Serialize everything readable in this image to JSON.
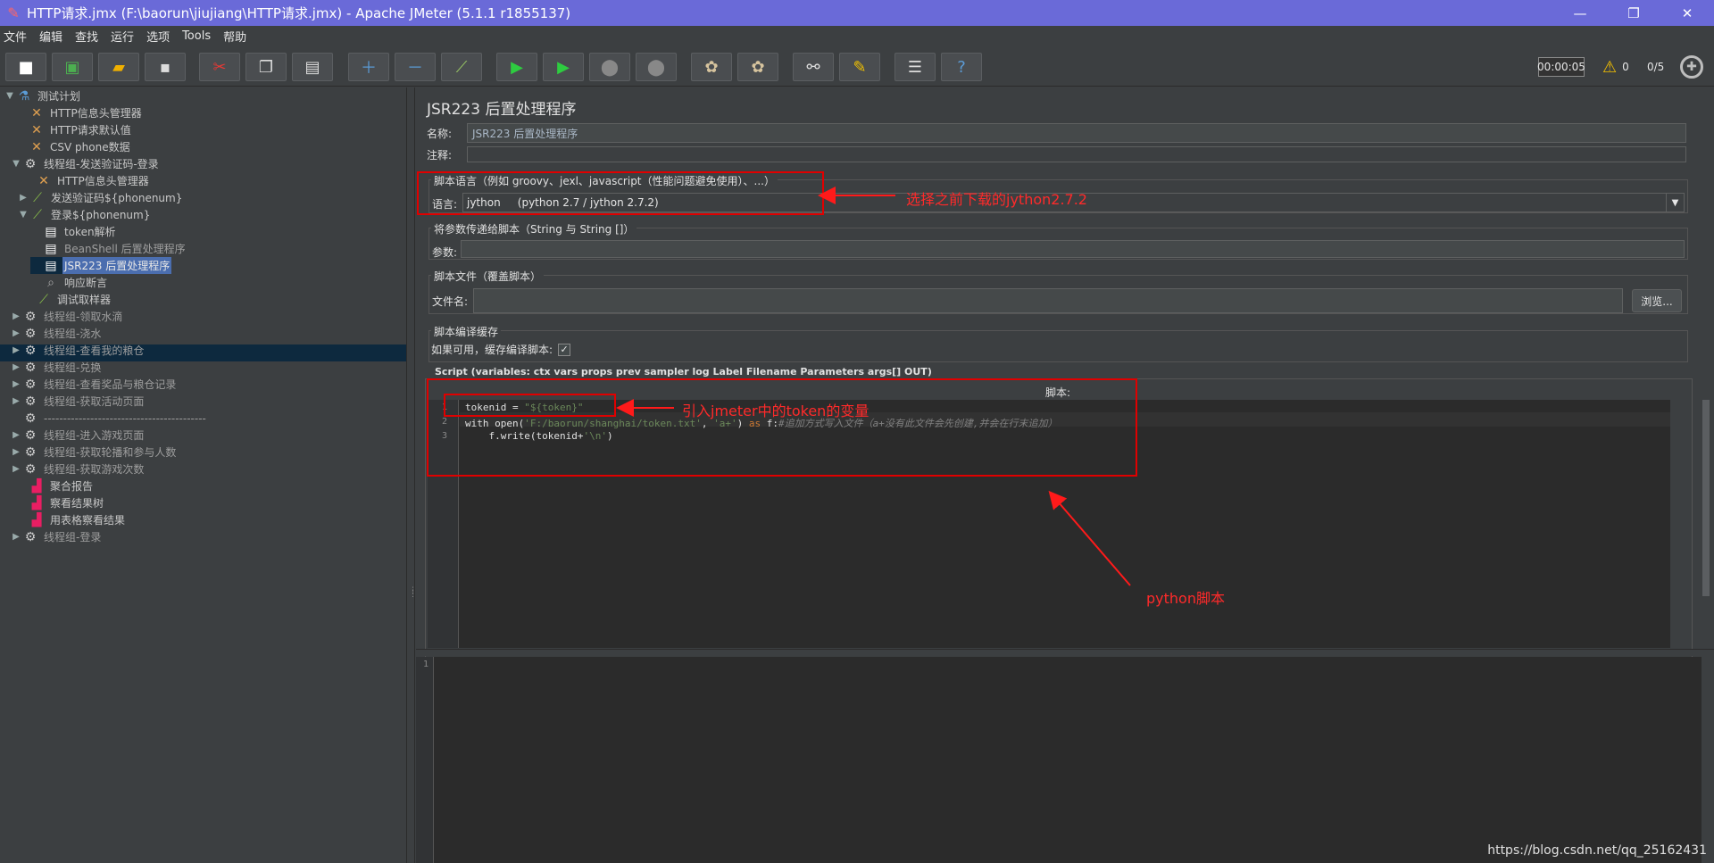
{
  "window": {
    "title": "HTTP请求.jmx (F:\\baorun\\jiujiang\\HTTP请求.jmx) - Apache JMeter (5.1.1 r1855137)",
    "minimize": "—",
    "restore": "❐",
    "close": "✕"
  },
  "menu": [
    "文件",
    "编辑",
    "查找",
    "运行",
    "选项",
    "Tools",
    "帮助"
  ],
  "toolbar": {
    "timer": "00:00:05",
    "warnings": "0",
    "threads": "0/5"
  },
  "tree": [
    {
      "label": "测试计划",
      "icon": "flask-icon"
    },
    {
      "label": "HTTP信息头管理器",
      "icon": "wrench-icon"
    },
    {
      "label": "HTTP请求默认值",
      "icon": "wrench-icon"
    },
    {
      "label": "CSV phone数据",
      "icon": "wrench-icon"
    },
    {
      "label": "线程组-发送验证码-登录",
      "icon": "gear-icon"
    },
    {
      "label": "HTTP信息头管理器",
      "icon": "wrench-icon"
    },
    {
      "label": "发送验证码${phonenum}",
      "icon": "pipette-icon"
    },
    {
      "label": "登录${phonenum}",
      "icon": "pipette-icon"
    },
    {
      "label": "token解析",
      "icon": "document-icon"
    },
    {
      "label": "BeanShell 后置处理程序",
      "icon": "document-icon"
    },
    {
      "label": "JSR223 后置处理程序",
      "icon": "document-icon"
    },
    {
      "label": "响应断言",
      "icon": "magnifier-icon"
    },
    {
      "label": "调试取样器",
      "icon": "pipette-icon"
    },
    {
      "label": "线程组-领取水滴",
      "icon": "gear-icon"
    },
    {
      "label": "线程组-浇水",
      "icon": "gear-icon"
    },
    {
      "label": "线程组-查看我的粮仓",
      "icon": "gear-icon"
    },
    {
      "label": "线程组-兑换",
      "icon": "gear-icon"
    },
    {
      "label": "线程组-查看奖品与粮仓记录",
      "icon": "gear-icon"
    },
    {
      "label": "线程组-获取活动页面",
      "icon": "gear-icon"
    },
    {
      "label": "------------------------------------------",
      "icon": "gear-icon"
    },
    {
      "label": "线程组-进入游戏页面",
      "icon": "gear-icon"
    },
    {
      "label": "线程组-获取轮播和参与人数",
      "icon": "gear-icon"
    },
    {
      "label": "线程组-获取游戏次数",
      "icon": "gear-icon"
    },
    {
      "label": "聚合报告",
      "icon": "chart-icon"
    },
    {
      "label": "察看结果树",
      "icon": "chart-icon"
    },
    {
      "label": "用表格察看结果",
      "icon": "chart-icon"
    },
    {
      "label": "线程组-登录",
      "icon": "gear-icon"
    }
  ],
  "panel": {
    "title": "JSR223 后置处理程序",
    "name_label": "名称:",
    "name_value": "JSR223 后置处理程序",
    "comment_label": "注释:",
    "lang_group": "脚本语言（例如 groovy、jexl、javascript（性能问题避免使用）、...）",
    "lang_label": "语言:",
    "lang_value": "jython     (python 2.7 / jython 2.7.2)",
    "params_group": "将参数传递给脚本（String 与 String []）",
    "params_label": "参数:",
    "file_group": "脚本文件（覆盖脚本）",
    "file_label": "文件名:",
    "browse": "浏览...",
    "cache_group": "脚本编译缓存",
    "cache_label": "如果可用，缓存编译脚本:",
    "script_group": "Script (variables: ctx vars props prev sampler log Label Filename Parameters args[] OUT)",
    "script_label": "脚本:"
  },
  "code": {
    "line1_var": "tokenid = ",
    "line1_str": "\"${token}\"",
    "line2_a": "with open(",
    "line2_s1": "'F:/baorun/shanghai/token.txt'",
    "line2_b": ", ",
    "line2_s2": "'a+'",
    "line2_c": ") ",
    "line2_as": "as",
    "line2_d": " f:",
    "line2_cm": "#追加方式写入文件（a+没有此文件会先创建,并会在行末追加）",
    "line3_a": "    f.write(tokenid+",
    "line3_s": "'\\n'",
    "line3_b": ")"
  },
  "annotations": {
    "lang_note": "选择之前下载的jython2.7.2",
    "token_note": "引入jmeter中的token的变量",
    "script_note": "python脚本"
  },
  "watermark": "https://blog.csdn.net/qq_25162431"
}
